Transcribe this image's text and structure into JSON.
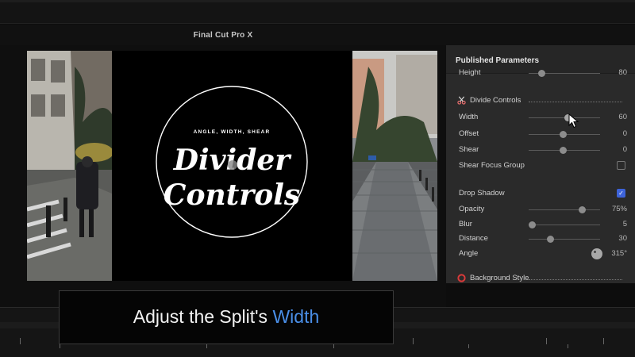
{
  "app": {
    "title": "Final Cut Pro X"
  },
  "viewer": {
    "title_card": {
      "subtitle": "ANGLE, WIDTH, SHEAR",
      "line1": "Divider",
      "line2": "Controls"
    }
  },
  "inspector": {
    "header": "Published Parameters",
    "height_row": {
      "label": "Height",
      "value": "80",
      "level": 0.18
    },
    "divide_controls": {
      "label": "Divide Controls",
      "icon": "scissors-icon"
    },
    "width": {
      "label": "Width",
      "value": "60",
      "level": 0.55
    },
    "offset": {
      "label": "Offset",
      "value": "0",
      "level": 0.48
    },
    "shear": {
      "label": "Shear",
      "value": "0",
      "level": 0.48
    },
    "shear_focus_group": {
      "label": "Shear Focus Group",
      "checked": false
    },
    "drop_shadow": {
      "label": "Drop Shadow",
      "checked": true
    },
    "opacity": {
      "label": "Opacity",
      "value": "75%",
      "level": 0.75
    },
    "blur": {
      "label": "Blur",
      "value": "5",
      "level": 0.05
    },
    "distance": {
      "label": "Distance",
      "value": "30",
      "level": 0.3
    },
    "angle": {
      "label": "Angle",
      "value": "315°"
    },
    "background_style": {
      "label": "Background Style",
      "icon": "lifebuoy-icon"
    }
  },
  "caption": {
    "prefix": "Adjust the Split's ",
    "highlight": "Width"
  },
  "colors": {
    "accent_blue": "#4a8fe8",
    "checkbox_blue": "#3d63d9",
    "panel": "#2a2a2a"
  }
}
